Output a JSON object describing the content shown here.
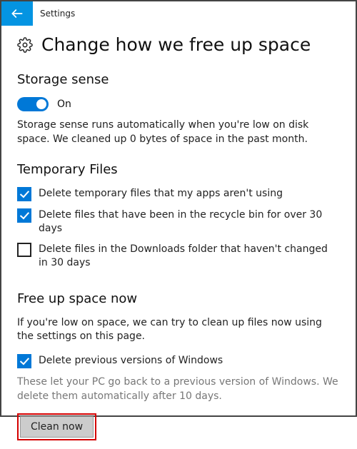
{
  "titlebar": {
    "label": "Settings"
  },
  "page": {
    "title": "Change how we free up space"
  },
  "storageSense": {
    "heading": "Storage sense",
    "toggleState": "On",
    "description": "Storage sense runs automatically when you're low on disk space. We cleaned up 0 bytes of space in the past month."
  },
  "temporaryFiles": {
    "heading": "Temporary Files",
    "options": [
      {
        "label": "Delete temporary files that my apps aren't using",
        "checked": true
      },
      {
        "label": "Delete files that have been in the recycle bin for over 30 days",
        "checked": true
      },
      {
        "label": "Delete files in the Downloads folder that haven't changed in 30 days",
        "checked": false
      }
    ]
  },
  "freeUpNow": {
    "heading": "Free up space now",
    "description": "If you're low on space, we can try to clean up files now using the settings on this page.",
    "previousVersions": {
      "label": "Delete previous versions of Windows",
      "checked": true
    },
    "help": "These let your PC go back to a previous version of Windows. We delete them automatically after 10 days.",
    "button": "Clean now"
  }
}
